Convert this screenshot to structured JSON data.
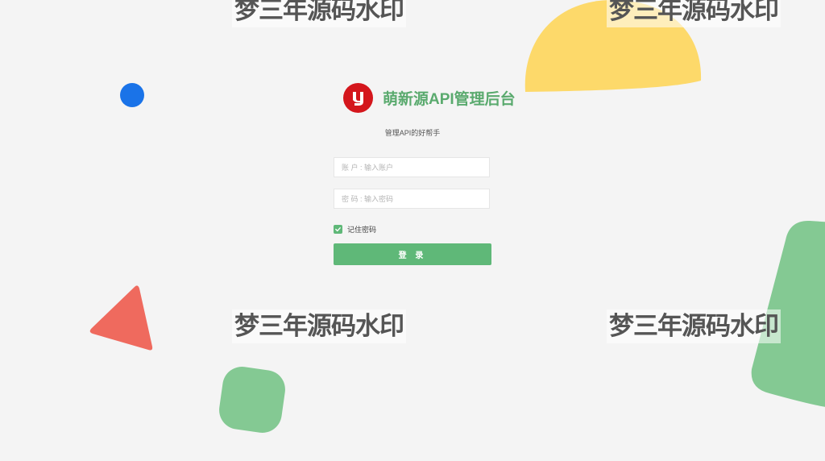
{
  "watermark_text": "梦三年源码水印",
  "brand": {
    "title": "萌新源API管理后台",
    "subtitle": "管理API的好帮手",
    "logo_icon": "stylized-y-logo",
    "logo_color": "#d4161c",
    "title_color": "#5aaa6e"
  },
  "form": {
    "account": {
      "placeholder": "账 户 : 输入账户",
      "value": ""
    },
    "password": {
      "placeholder": "密 码 : 输入密码",
      "value": ""
    },
    "remember": {
      "label": "记住密码",
      "checked": true
    },
    "login_label": "登 录"
  },
  "decor": {
    "background": "#f4f4f4",
    "accent_green": "#5fb878",
    "blue": "#1a73e8",
    "yellow": "#fdd96a",
    "red": "#ef6a5e",
    "green_light": "#84c993"
  }
}
